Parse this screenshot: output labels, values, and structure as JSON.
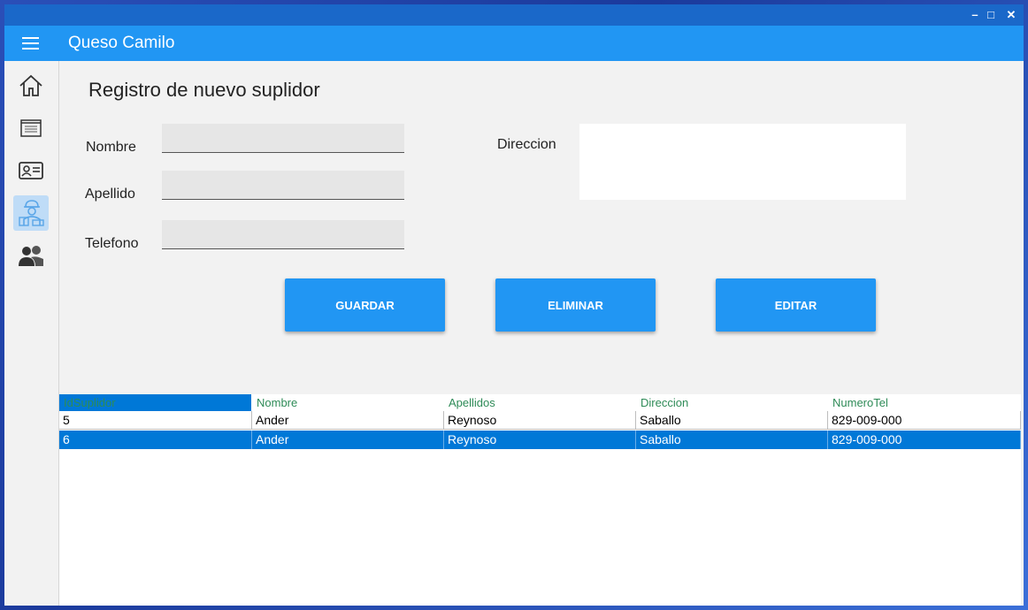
{
  "window_controls": {
    "minimize": "–",
    "maximize": "□",
    "close": "✕"
  },
  "appbar": {
    "title": "Queso Camilo",
    "menu_icon": "hamburger-icon"
  },
  "sidebar": {
    "items": [
      {
        "icon": "home-icon"
      },
      {
        "icon": "list-icon"
      },
      {
        "icon": "contact-card-icon"
      },
      {
        "icon": "supplier-icon",
        "active": true
      },
      {
        "icon": "users-icon"
      }
    ]
  },
  "form": {
    "title": "Registro de nuevo suplidor",
    "nombre_label": "Nombre",
    "nombre_value": "",
    "apellido_label": "Apellido",
    "apellido_value": "",
    "telefono_label": "Telefono",
    "telefono_value": "",
    "direccion_label": "Direccion",
    "direccion_value": ""
  },
  "buttons": {
    "guardar": "GUARDAR",
    "eliminar": "ELIMINAR",
    "editar": "EDITAR"
  },
  "grid": {
    "columns": [
      "IdSuplidor",
      "Nombre",
      "Apellidos",
      "Direccion",
      "NumeroTel"
    ],
    "rows": [
      [
        "5",
        "Ander",
        "Reynoso",
        "Saballo",
        "829-009-000"
      ],
      [
        "6",
        "Ander",
        "Reynoso",
        "Saballo",
        "829-009-000"
      ]
    ],
    "selected_row": 1
  },
  "colors": {
    "accent": "#2196f3",
    "titlebar": "#1a68c9",
    "selection": "#0078d7",
    "header_text": "#2e8b57"
  }
}
